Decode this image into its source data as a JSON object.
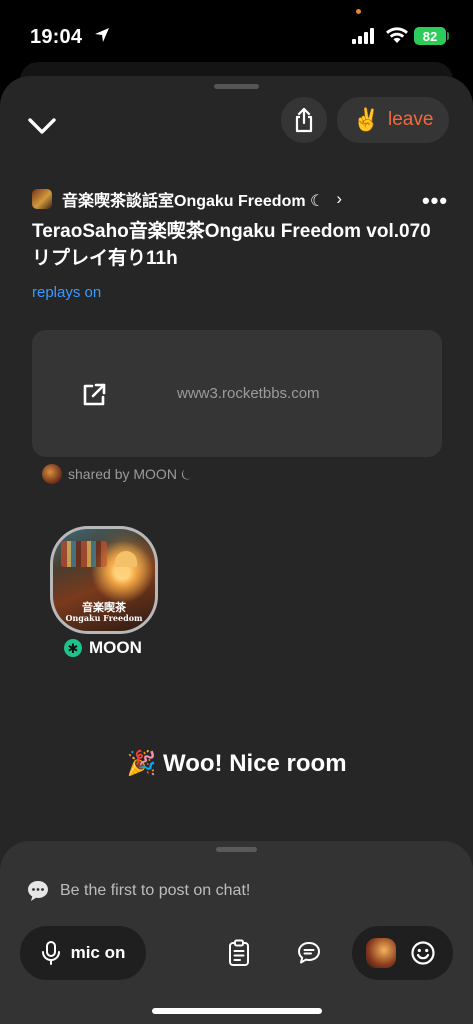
{
  "status_bar": {
    "time": "19:04",
    "battery": "82",
    "icons": [
      "location-arrow-icon",
      "signal-icon",
      "wifi-icon",
      "battery-icon"
    ]
  },
  "header": {
    "leave_emoji": "✌️",
    "leave_label": "leave",
    "icons": [
      "chevron-down-icon",
      "share-icon",
      "more-icon"
    ]
  },
  "room": {
    "club_name": "音楽喫茶談話室Ongaku  Freedom ☾",
    "club_chevron": "›",
    "more": "•••",
    "title": "TeraoSaho音楽喫茶Ongaku Freedom vol.070リプレイ有り11h",
    "replays_label": "replays on"
  },
  "link": {
    "url": "www3.rocketbbs.com",
    "shared_by": "shared by MOON ⏾"
  },
  "speaker": {
    "name": "MOON",
    "badge": "✱",
    "avatar_caption_1": "音楽喫茶",
    "avatar_caption_2": "Ongaku Freedom"
  },
  "nice_room": "🎉 Woo! Nice room",
  "chat": {
    "placeholder": "Be the first to post on chat!"
  },
  "toolbar": {
    "mic_label": "mic on",
    "icons": [
      "mic-icon",
      "clipboard-icon",
      "chat-icon",
      "avatar",
      "smiley-icon"
    ]
  },
  "colors": {
    "accent_leave": "#f26a3c",
    "link_blue": "#3a99ff",
    "moderator_green": "#1ec28b",
    "battery_green": "#2fcb5a"
  }
}
